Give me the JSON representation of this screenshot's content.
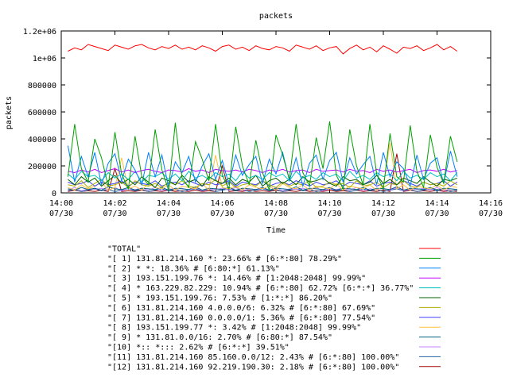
{
  "chart_data": {
    "type": "line",
    "title": "packets",
    "xlabel": "Time",
    "ylabel": "packets",
    "ylim": [
      0,
      1200000
    ],
    "y_ticks": [
      {
        "value": 0,
        "label": "0"
      },
      {
        "value": 200000,
        "label": "200000"
      },
      {
        "value": 400000,
        "label": "400000"
      },
      {
        "value": 600000,
        "label": "600000"
      },
      {
        "value": 800000,
        "label": "800000"
      },
      {
        "value": 1000000,
        "label": "1e+06"
      },
      {
        "value": 1200000,
        "label": "1.2e+06"
      }
    ],
    "xlim": [
      "14:00",
      "14:16"
    ],
    "x_ticks": [
      {
        "value": "14:00",
        "line1": "14:00",
        "line2": "07/30"
      },
      {
        "value": "14:02",
        "line1": "14:02",
        "line2": "07/30"
      },
      {
        "value": "14:04",
        "line1": "14:04",
        "line2": "07/30"
      },
      {
        "value": "14:06",
        "line1": "14:06",
        "line2": "07/30"
      },
      {
        "value": "14:08",
        "line1": "14:08",
        "line2": "07/30"
      },
      {
        "value": "14:10",
        "line1": "14:10",
        "line2": "07/30"
      },
      {
        "value": "14:12",
        "line1": "14:12",
        "line2": "07/30"
      },
      {
        "value": "14:14",
        "line1": "14:14",
        "line2": "07/30"
      },
      {
        "value": "14:16",
        "line1": "14:16",
        "line2": "07/30"
      }
    ],
    "x_times": [
      "14:00:15",
      "14:00:30",
      "14:00:45",
      "14:01:00",
      "14:01:15",
      "14:01:30",
      "14:01:45",
      "14:02:00",
      "14:02:15",
      "14:02:30",
      "14:02:45",
      "14:03:00",
      "14:03:15",
      "14:03:30",
      "14:03:45",
      "14:04:00",
      "14:04:15",
      "14:04:30",
      "14:04:45",
      "14:05:00",
      "14:05:15",
      "14:05:30",
      "14:05:45",
      "14:06:00",
      "14:06:15",
      "14:06:30",
      "14:06:45",
      "14:07:00",
      "14:07:15",
      "14:07:30",
      "14:07:45",
      "14:08:00",
      "14:08:15",
      "14:08:30",
      "14:08:45",
      "14:09:00",
      "14:09:15",
      "14:09:30",
      "14:09:45",
      "14:10:00",
      "14:10:15",
      "14:10:30",
      "14:10:45",
      "14:11:00",
      "14:11:15",
      "14:11:30",
      "14:11:45",
      "14:12:00",
      "14:12:15",
      "14:12:30",
      "14:12:45",
      "14:13:00",
      "14:13:15",
      "14:13:30",
      "14:13:45",
      "14:14:00",
      "14:14:15",
      "14:14:30",
      "14:14:45"
    ],
    "grid": false,
    "legend_position": "bottom",
    "series": [
      {
        "name": "\"TOTAL\"",
        "color": "#ff0000",
        "values": [
          1050000,
          1075000,
          1060000,
          1100000,
          1085000,
          1070000,
          1055000,
          1095000,
          1080000,
          1065000,
          1090000,
          1100000,
          1075000,
          1060000,
          1085000,
          1070000,
          1095000,
          1065000,
          1080000,
          1060000,
          1090000,
          1075000,
          1050000,
          1085000,
          1095000,
          1065000,
          1080000,
          1055000,
          1090000,
          1070000,
          1060000,
          1085000,
          1075000,
          1050000,
          1095000,
          1080000,
          1065000,
          1090000,
          1055000,
          1075000,
          1085000,
          1030000,
          1070000,
          1095000,
          1060000,
          1080000,
          1045000,
          1090000,
          1065000,
          1035000,
          1080000,
          1070000,
          1090000,
          1055000,
          1075000,
          1100000,
          1060000,
          1085000,
          1050000
        ]
      },
      {
        "name": "\"[ 1] 131.81.214.160 *: 23.66% # [6:*:80] 78.29%\"",
        "color": "#00a000",
        "values": [
          120000,
          510000,
          180000,
          80000,
          400000,
          260000,
          50000,
          450000,
          140000,
          30000,
          420000,
          120000,
          60000,
          470000,
          170000,
          20000,
          520000,
          110000,
          40000,
          380000,
          250000,
          90000,
          510000,
          130000,
          30000,
          490000,
          200000,
          60000,
          390000,
          150000,
          20000,
          430000,
          280000,
          100000,
          510000,
          150000,
          50000,
          410000,
          180000,
          530000,
          130000,
          30000,
          470000,
          200000,
          60000,
          510000,
          140000,
          30000,
          440000,
          120000,
          80000,
          500000,
          160000,
          40000,
          430000,
          190000,
          70000,
          420000,
          230000
        ]
      },
      {
        "name": "\"[ 2] * *: 18.36% # [6:80:*] 61.13%\"",
        "color": "#0080ff",
        "values": [
          350000,
          80000,
          270000,
          120000,
          300000,
          60000,
          220000,
          290000,
          90000,
          250000,
          170000,
          60000,
          300000,
          120000,
          280000,
          40000,
          230000,
          150000,
          270000,
          80000,
          200000,
          290000,
          100000,
          240000,
          60000,
          280000,
          130000,
          210000,
          270000,
          70000,
          250000,
          140000,
          300000,
          90000,
          260000,
          50000,
          220000,
          280000,
          100000,
          240000,
          300000,
          80000,
          260000,
          140000,
          210000,
          270000,
          60000,
          300000,
          120000,
          230000,
          180000,
          50000,
          280000,
          100000,
          220000,
          260000,
          70000,
          310000,
          120000
        ]
      },
      {
        "name": "\"[ 3] 193.151.199.76 *: 14.46% # [1:2048:2048] 99.99%\"",
        "color": "#c000ff",
        "values": [
          160000,
          150000,
          170000,
          155000,
          175000,
          150000,
          165000,
          180000,
          155000,
          170000,
          150000,
          165000,
          175000,
          160000,
          150000,
          170000,
          165000,
          155000,
          180000,
          160000,
          170000,
          150000,
          175000,
          165000,
          160000,
          170000,
          155000,
          175000,
          165000,
          150000,
          170000,
          160000,
          175000,
          155000,
          165000,
          170000,
          150000,
          175000,
          160000,
          165000,
          170000,
          155000,
          175000,
          160000,
          165000,
          150000,
          175000,
          160000,
          170000,
          155000,
          165000,
          175000,
          150000,
          165000,
          170000,
          160000,
          175000,
          155000,
          165000
        ]
      },
      {
        "name": "\"[ 4] * 163.229.82.229: 10.94% # [6:*:80] 62.72% [6:*:*] 36.77%\"",
        "color": "#00c0c0",
        "values": [
          140000,
          100000,
          160000,
          120000,
          130000,
          90000,
          150000,
          110000,
          140000,
          100000,
          160000,
          80000,
          130000,
          120000,
          150000,
          100000,
          140000,
          90000,
          160000,
          110000,
          130000,
          100000,
          150000,
          120000,
          140000,
          90000,
          160000,
          110000,
          130000,
          100000,
          150000,
          120000,
          140000,
          90000,
          160000,
          110000,
          130000,
          100000,
          150000,
          120000,
          140000,
          90000,
          160000,
          110000,
          130000,
          100000,
          150000,
          120000,
          140000,
          90000,
          160000,
          110000,
          130000,
          100000,
          150000,
          120000,
          140000,
          90000,
          150000
        ]
      },
      {
        "name": "\"[ 5] * 193.151.199.76: 7.53% # [1:*:*] 86.20%\"",
        "color": "#006000",
        "values": [
          100000,
          60000,
          120000,
          80000,
          110000,
          50000,
          90000,
          130000,
          70000,
          100000,
          60000,
          120000,
          80000,
          40000,
          110000,
          90000,
          60000,
          130000,
          80000,
          100000,
          50000,
          120000,
          90000,
          70000,
          110000,
          60000,
          100000,
          80000,
          130000,
          50000,
          90000,
          110000,
          70000,
          100000,
          60000,
          120000,
          80000,
          90000,
          110000,
          70000,
          50000,
          120000,
          90000,
          100000,
          60000,
          80000,
          130000,
          70000,
          100000,
          60000,
          110000,
          90000,
          70000,
          120000,
          80000,
          50000,
          100000,
          90000,
          110000
        ]
      },
      {
        "name": "\"[ 6] 131.81.214.160 4.0.0.0/6: 6.32% # [6:*:80] 67.69%\"",
        "color": "#b0b000",
        "values": [
          60000,
          50000,
          90000,
          40000,
          70000,
          100000,
          50000,
          60000,
          80000,
          40000,
          90000,
          60000,
          50000,
          70000,
          40000,
          80000,
          60000,
          90000,
          50000,
          40000,
          70000,
          60000,
          100000,
          50000,
          80000,
          40000,
          60000,
          70000,
          50000,
          90000,
          60000,
          40000,
          80000,
          50000,
          70000,
          60000,
          90000,
          40000,
          50000,
          80000,
          60000,
          70000,
          40000,
          90000,
          50000,
          60000,
          80000,
          40000,
          70000,
          60000,
          90000,
          50000,
          40000,
          80000,
          60000,
          70000,
          50000,
          90000,
          60000
        ]
      },
      {
        "name": "\"[ 7] 131.81.214.160 0.0.0.0/1: 5.36% # [6:*:80] 77.54%\"",
        "color": "#4040ff",
        "values": [
          80000,
          60000,
          70000,
          90000,
          50000,
          80000,
          60000,
          70000,
          90000,
          50000,
          80000,
          70000,
          60000,
          90000,
          50000,
          70000,
          80000,
          60000,
          90000,
          70000,
          50000,
          80000,
          60000,
          70000,
          90000,
          50000,
          80000,
          70000,
          60000,
          90000,
          50000,
          70000,
          80000,
          60000,
          90000,
          70000,
          50000,
          80000,
          60000,
          70000,
          90000,
          50000,
          80000,
          70000,
          60000,
          90000,
          50000,
          70000,
          80000,
          60000,
          90000,
          70000,
          50000,
          80000,
          60000,
          70000,
          90000,
          50000,
          80000
        ]
      },
      {
        "name": "\"[ 8] 193.151.199.77 *: 3.42% # [1:2048:2048] 99.99%\"",
        "color": "#ffc040",
        "values": [
          40000,
          20000,
          60000,
          30000,
          50000,
          80000,
          20000,
          40000,
          260000,
          30000,
          50000,
          20000,
          70000,
          40000,
          30000,
          60000,
          20000,
          50000,
          40000,
          30000,
          70000,
          20000,
          280000,
          40000,
          30000,
          50000,
          20000,
          60000,
          40000,
          30000,
          50000,
          20000,
          70000,
          40000,
          30000,
          60000,
          20000,
          50000,
          40000,
          30000,
          70000,
          20000,
          50000,
          40000,
          30000,
          60000,
          20000,
          50000,
          370000,
          30000,
          60000,
          20000,
          50000,
          40000,
          30000,
          60000,
          20000,
          50000,
          40000
        ]
      },
      {
        "name": "\"[ 9] * 131.81.0.0/16: 2.70% # [6:80:*] 87.54%\"",
        "color": "#006080",
        "values": [
          30000,
          20000,
          40000,
          25000,
          35000,
          20000,
          45000,
          30000,
          25000,
          40000,
          20000,
          35000,
          30000,
          25000,
          40000,
          20000,
          35000,
          30000,
          25000,
          45000,
          20000,
          35000,
          30000,
          25000,
          40000,
          20000,
          35000,
          30000,
          25000,
          40000,
          20000,
          35000,
          30000,
          25000,
          45000,
          20000,
          35000,
          30000,
          25000,
          40000,
          20000,
          35000,
          30000,
          25000,
          40000,
          20000,
          35000,
          30000,
          25000,
          45000,
          20000,
          35000,
          30000,
          25000,
          40000,
          20000,
          35000,
          30000,
          25000
        ]
      },
      {
        "name": "\"[10] *:: *::: 2.62% # [6:*:*] 39.51%\"",
        "color": "#c080ff",
        "values": [
          20000,
          40000,
          15000,
          30000,
          25000,
          35000,
          20000,
          40000,
          15000,
          30000,
          25000,
          35000,
          20000,
          40000,
          15000,
          30000,
          25000,
          35000,
          20000,
          40000,
          15000,
          30000,
          25000,
          35000,
          20000,
          40000,
          15000,
          30000,
          25000,
          35000,
          20000,
          40000,
          15000,
          30000,
          25000,
          35000,
          20000,
          40000,
          15000,
          30000,
          25000,
          35000,
          20000,
          40000,
          15000,
          30000,
          25000,
          35000,
          20000,
          40000,
          15000,
          30000,
          25000,
          35000,
          20000,
          40000,
          15000,
          30000,
          25000
        ]
      },
      {
        "name": "\"[11] 131.81.214.160 85.160.0.0/12: 2.43% # [6:*:80] 100.00%\"",
        "color": "#2060a0",
        "values": [
          15000,
          25000,
          10000,
          20000,
          30000,
          15000,
          25000,
          10000,
          20000,
          30000,
          15000,
          25000,
          10000,
          20000,
          30000,
          15000,
          25000,
          10000,
          20000,
          30000,
          15000,
          25000,
          10000,
          20000,
          30000,
          15000,
          25000,
          10000,
          20000,
          30000,
          15000,
          25000,
          10000,
          20000,
          30000,
          15000,
          25000,
          10000,
          20000,
          30000,
          15000,
          25000,
          10000,
          20000,
          30000,
          15000,
          25000,
          10000,
          20000,
          30000,
          15000,
          25000,
          10000,
          20000,
          30000,
          15000,
          25000,
          10000,
          20000
        ]
      },
      {
        "name": "\"[12] 131.81.214.160 92.219.190.30: 2.18% # [6:*:80] 100.00%\"",
        "color": "#a00000",
        "values": [
          10000,
          20000,
          10000,
          15000,
          10000,
          20000,
          10000,
          180000,
          10000,
          15000,
          10000,
          20000,
          10000,
          15000,
          10000,
          20000,
          10000,
          15000,
          10000,
          20000,
          10000,
          15000,
          10000,
          200000,
          10000,
          15000,
          10000,
          20000,
          10000,
          15000,
          10000,
          20000,
          10000,
          15000,
          10000,
          20000,
          10000,
          15000,
          10000,
          20000,
          10000,
          15000,
          10000,
          20000,
          10000,
          15000,
          10000,
          20000,
          10000,
          290000,
          10000,
          20000,
          10000,
          15000,
          10000,
          20000,
          10000,
          15000,
          10000
        ]
      }
    ]
  }
}
